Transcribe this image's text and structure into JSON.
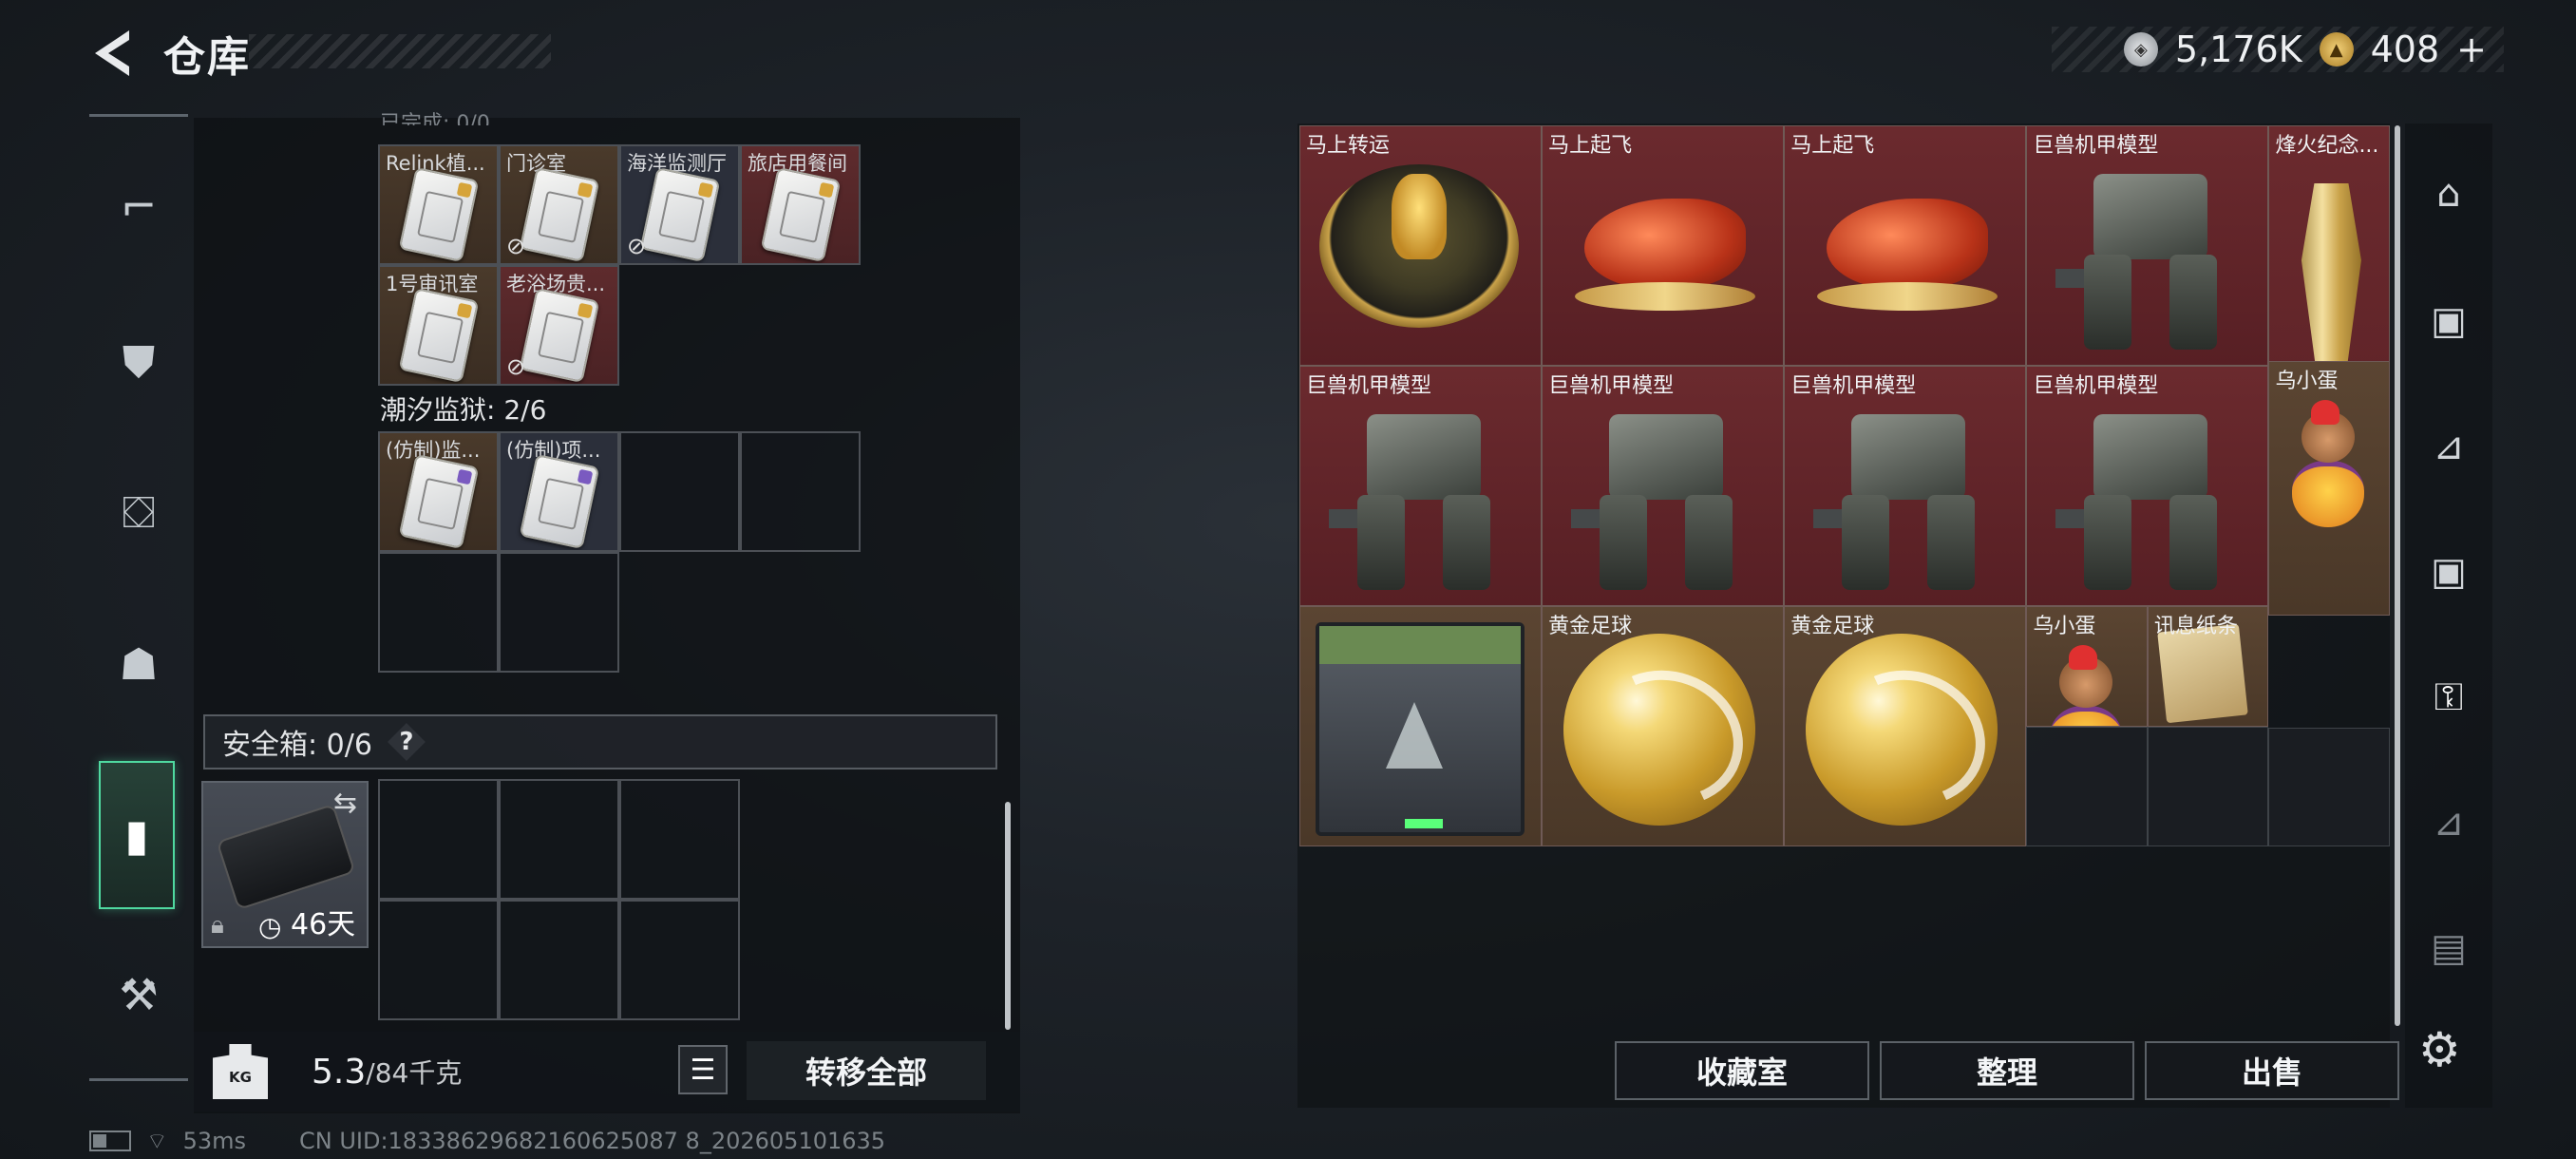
{
  "header": {
    "title": "仓库",
    "currency_1_value": "5,176K",
    "currency_2_value": "408",
    "currency_2_add": "+"
  },
  "left_nav": {
    "items": [
      "gun-icon",
      "vest-icon",
      "backpack-icon",
      "helmet-icon",
      "case-icon",
      "toolbox-icon"
    ],
    "active_index": 4
  },
  "left_panel": {
    "partial_header": "已完成: 0/0",
    "group1_items": [
      {
        "label": "Relink植...",
        "color": "brown",
        "card": "gold"
      },
      {
        "label": "门诊室",
        "color": "brown",
        "card": "gold",
        "no_sell": true
      },
      {
        "label": "海洋监测厅",
        "color": "dark",
        "card": "gold",
        "no_sell": true
      },
      {
        "label": "旅店用餐间",
        "color": "red",
        "card": "gold"
      },
      {
        "label": "1号审讯室",
        "color": "brown",
        "card": "gold"
      },
      {
        "label": "老浴场贵...",
        "color": "red",
        "card": "gold",
        "no_sell": true
      }
    ],
    "group2_title": "潮汐监狱: 2/6",
    "group2_items": [
      {
        "label": "(仿制)监...",
        "color": "brown",
        "card": "purple"
      },
      {
        "label": "(仿制)项...",
        "color": "dark",
        "card": "purple"
      }
    ],
    "safebox": {
      "label": "安全箱: 0/6",
      "help": "?",
      "days": "46天"
    },
    "footer": {
      "weight_icon_text": "KG",
      "weight_current": "5.3",
      "weight_max": "/84千克",
      "transfer_all": "转移全部"
    }
  },
  "right_panel": {
    "items": [
      {
        "label": "马上转运",
        "type": "disc",
        "color": "red"
      },
      {
        "label": "马上起飞",
        "type": "horse",
        "color": "red"
      },
      {
        "label": "马上起飞",
        "type": "horse",
        "color": "red"
      },
      {
        "label": "巨兽机甲模型",
        "type": "mech",
        "color": "red"
      },
      {
        "label": "烽火纪念...",
        "type": "trophy",
        "color": "red"
      },
      {
        "label": "巨兽机甲模型",
        "type": "mech",
        "color": "red"
      },
      {
        "label": "巨兽机甲模型",
        "type": "mech",
        "color": "red"
      },
      {
        "label": "巨兽机甲模型",
        "type": "mech",
        "color": "red"
      },
      {
        "label": "巨兽机甲模型",
        "type": "mech",
        "color": "red"
      },
      {
        "label": "乌小蛋",
        "type": "monkey",
        "color": "brown"
      },
      {
        "label": "",
        "type": "crate",
        "color": "brown"
      },
      {
        "label": "黄金足球",
        "type": "ball",
        "color": "brown"
      },
      {
        "label": "黄金足球",
        "type": "ball",
        "color": "brown"
      },
      {
        "label": "乌小蛋",
        "type": "monkey",
        "color": "brown"
      },
      {
        "label": "讯息纸条",
        "type": "paper",
        "color": "brown"
      }
    ],
    "buttons": {
      "collection": "收藏室",
      "organize": "整理",
      "sell": "出售"
    }
  },
  "right_nav": {
    "items": [
      "arch-icon",
      "tier-v-case-icon",
      "tier-iii-case-icon",
      "tier-iv-case-icon",
      "tier-iv-key-icon",
      "tier-iii-crate-icon",
      "tier-iv-box-icon"
    ],
    "active_index": 4
  },
  "status_bar": {
    "ping": "53ms",
    "uid": "CN UID:18338629682160625087 8_202605101635"
  },
  "colors": {
    "accent": "#4fd9a0",
    "red_rarity": "#5e2b2d",
    "gold_rarity": "#4a3a2b"
  }
}
